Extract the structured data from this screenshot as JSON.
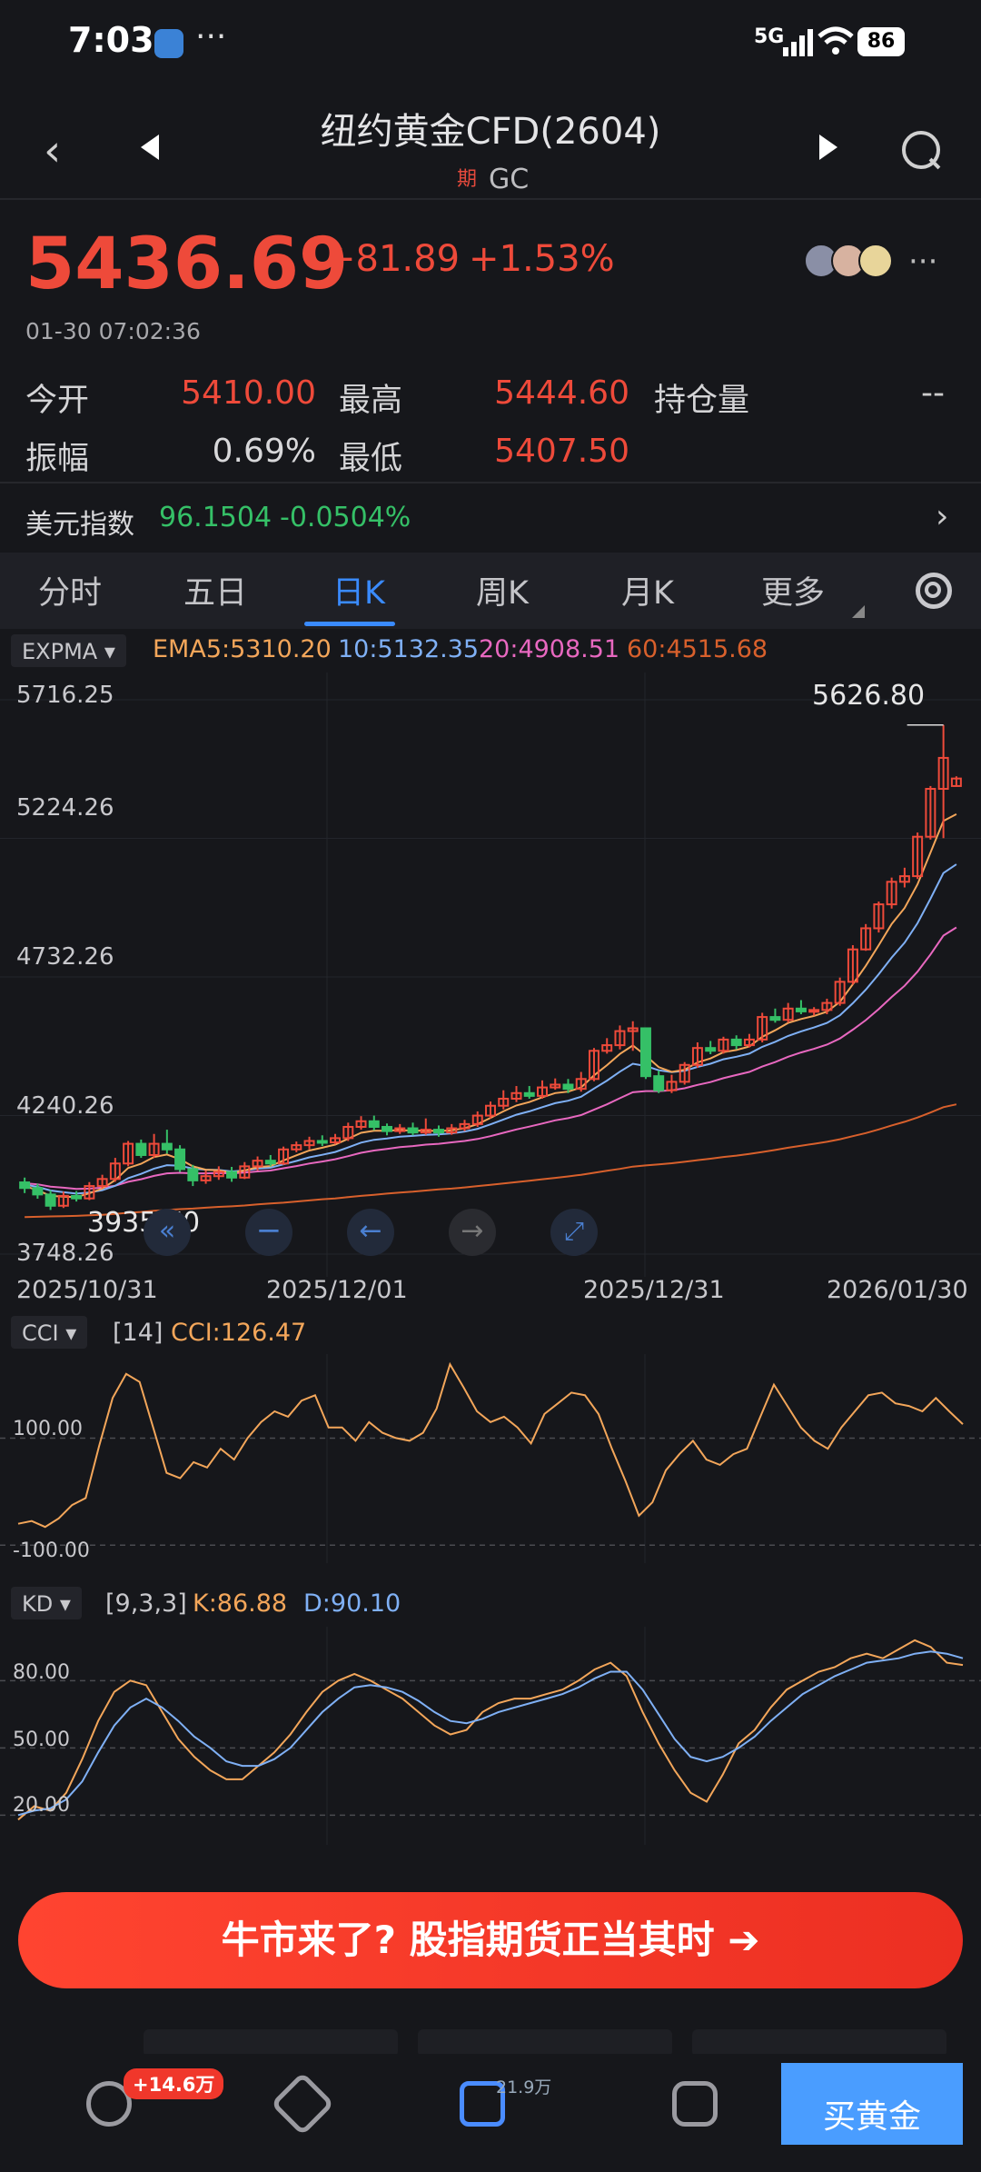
{
  "status": {
    "time": "7:03",
    "dots": "···",
    "signal": "5G",
    "battery": "86"
  },
  "header": {
    "title": "纽约黄金CFD(2604)",
    "tag": "期",
    "code": "GC"
  },
  "quote": {
    "price": "5436.69",
    "change": "+81.89",
    "change_pct": "+1.53%",
    "timestamp": "01-30 07:02:36",
    "stats": [
      {
        "label": "今开",
        "value": "5410.00"
      },
      {
        "label": "最高",
        "value": "5444.60"
      },
      {
        "label": "持仓量",
        "value": "--"
      },
      {
        "label": "振幅",
        "value": "0.69%"
      },
      {
        "label": "最低",
        "value": "5407.50"
      }
    ]
  },
  "usd_index": {
    "label": "美元指数",
    "value": "96.1504",
    "change": "-0.0504%"
  },
  "tabs": [
    {
      "label": "分时",
      "active": false
    },
    {
      "label": "五日",
      "active": false
    },
    {
      "label": "日K",
      "active": true
    },
    {
      "label": "周K",
      "active": false
    },
    {
      "label": "月K",
      "active": false
    },
    {
      "label": "更多",
      "active": false
    }
  ],
  "indicators": {
    "main": {
      "name": "EXPMA",
      "ema5": "EMA5:5310.20",
      "ema10": "10:5132.35",
      "ema20": "20:4908.51",
      "ema60": "60:4515.68"
    },
    "cci": {
      "name": "CCI",
      "param": "[14]",
      "value": "CCI:126.47"
    },
    "kd": {
      "name": "KD",
      "param": "[9,3,3]",
      "k": "K:86.88",
      "d": "D:90.10"
    }
  },
  "colors": {
    "up": "#ee4a3a",
    "down": "#35c067",
    "accent": "#3a8bff",
    "ema5": "#f3a65a",
    "ema10": "#7fb0f5",
    "ema20": "#e868c0",
    "ema60": "#d8602c"
  },
  "chart_data": [
    {
      "type": "candlestick",
      "y_ticks": [
        "5716.25",
        "5224.26",
        "4732.26",
        "4240.26",
        "3748.26"
      ],
      "x_labels": [
        "2025/10/31",
        "2025/12/01",
        "2025/12/31",
        "2026/01/30"
      ],
      "ylim": [
        3748.26,
        5716.25
      ],
      "max_label": "5626.80",
      "min_label": "3935.70",
      "candles": [
        [
          4003,
          3983,
          4020,
          3965
        ],
        [
          3983,
          3960,
          3998,
          3945
        ],
        [
          3960,
          3920,
          3975,
          3905
        ],
        [
          3920,
          3955,
          3970,
          3912
        ],
        [
          3955,
          3946,
          3972,
          3935
        ],
        [
          3946,
          3990,
          4004,
          3940
        ],
        [
          3990,
          4015,
          4030,
          3982
        ],
        [
          4015,
          4070,
          4090,
          4005
        ],
        [
          4070,
          4140,
          4150,
          4060
        ],
        [
          4140,
          4100,
          4155,
          4090
        ],
        [
          4100,
          4140,
          4175,
          4090
        ],
        [
          4140,
          4120,
          4190,
          4105
        ],
        [
          4120,
          4050,
          4135,
          4040
        ],
        [
          4050,
          4010,
          4065,
          3990
        ],
        [
          4010,
          4025,
          4045,
          3998
        ],
        [
          4025,
          4040,
          4060,
          4012
        ],
        [
          4040,
          4020,
          4058,
          4005
        ],
        [
          4020,
          4060,
          4075,
          4015
        ],
        [
          4060,
          4080,
          4095,
          4045
        ],
        [
          4080,
          4070,
          4100,
          4060
        ],
        [
          4070,
          4120,
          4130,
          4065
        ],
        [
          4120,
          4135,
          4148,
          4110
        ],
        [
          4135,
          4150,
          4165,
          4120
        ],
        [
          4150,
          4145,
          4170,
          4132
        ],
        [
          4145,
          4160,
          4175,
          4138
        ],
        [
          4160,
          4200,
          4215,
          4150
        ],
        [
          4200,
          4220,
          4238,
          4190
        ],
        [
          4220,
          4200,
          4240,
          4188
        ],
        [
          4200,
          4185,
          4212,
          4170
        ],
        [
          4185,
          4195,
          4210,
          4175
        ],
        [
          4195,
          4180,
          4215,
          4170
        ],
        [
          4180,
          4190,
          4230,
          4172
        ],
        [
          4190,
          4180,
          4205,
          4165
        ],
        [
          4180,
          4195,
          4210,
          4172
        ],
        [
          4195,
          4210,
          4225,
          4185
        ],
        [
          4210,
          4240,
          4255,
          4200
        ],
        [
          4240,
          4275,
          4290,
          4230
        ],
        [
          4275,
          4300,
          4330,
          4262
        ],
        [
          4300,
          4320,
          4345,
          4288
        ],
        [
          4320,
          4310,
          4345,
          4300
        ],
        [
          4310,
          4340,
          4365,
          4300
        ],
        [
          4340,
          4350,
          4372,
          4332
        ],
        [
          4350,
          4335,
          4370,
          4320
        ],
        [
          4335,
          4370,
          4395,
          4325
        ],
        [
          4370,
          4470,
          4480,
          4362
        ],
        [
          4470,
          4490,
          4515,
          4460
        ],
        [
          4490,
          4540,
          4560,
          4475
        ],
        [
          4540,
          4550,
          4575,
          4470
        ],
        [
          4550,
          4380,
          4552,
          4370
        ],
        [
          4380,
          4330,
          4400,
          4320
        ],
        [
          4330,
          4360,
          4385,
          4320
        ],
        [
          4360,
          4420,
          4430,
          4350
        ],
        [
          4420,
          4480,
          4500,
          4410
        ],
        [
          4480,
          4470,
          4505,
          4458
        ],
        [
          4470,
          4510,
          4520,
          4460
        ],
        [
          4510,
          4490,
          4525,
          4475
        ],
        [
          4490,
          4510,
          4530,
          4482
        ],
        [
          4510,
          4590,
          4605,
          4500
        ],
        [
          4590,
          4580,
          4620,
          4570
        ],
        [
          4580,
          4620,
          4640,
          4570
        ],
        [
          4620,
          4610,
          4650,
          4600
        ],
        [
          4610,
          4615,
          4625,
          4595
        ],
        [
          4615,
          4640,
          4655,
          4600
        ],
        [
          4640,
          4715,
          4730,
          4630
        ],
        [
          4715,
          4830,
          4845,
          4705
        ],
        [
          4830,
          4905,
          4920,
          4825
        ],
        [
          4905,
          4990,
          5000,
          4890
        ],
        [
          4990,
          5070,
          5085,
          4975
        ],
        [
          5070,
          5090,
          5120,
          5050
        ],
        [
          5090,
          5230,
          5245,
          5080
        ],
        [
          5230,
          5400,
          5410,
          5220
        ],
        [
          5400,
          5510,
          5626.8,
          5225
        ],
        [
          5410,
          5436.69,
          5444.6,
          5407.5
        ]
      ],
      "ema5": [
        3990,
        3975,
        3955,
        3952,
        3951,
        3964,
        3981,
        4011,
        4054,
        4069,
        4093,
        4102,
        4085,
        4060,
        4048,
        4046,
        4037,
        4045,
        4057,
        4061,
        4081,
        4099,
        4116,
        4126,
        4137,
        4158,
        4179,
        4186,
        4186,
        4189,
        4186,
        4187,
        4185,
        4188,
        4195,
        4210,
        4232,
        4255,
        4276,
        4288,
        4305,
        4320,
        4325,
        4340,
        4383,
        4419,
        4459,
        4489,
        4453,
        4412,
        4395,
        4403,
        4429,
        4443,
        4465,
        4473,
        4485,
        4520,
        4543,
        4569,
        4583,
        4594,
        4609,
        4644,
        4706,
        4772,
        4845,
        4920,
        4977,
        5061,
        5174,
        5286,
        5310
      ],
      "ema10": [
        3995,
        3987,
        3974,
        3968,
        3963,
        3967,
        3975,
        3991,
        4018,
        4033,
        4052,
        4064,
        4062,
        4052,
        4048,
        4047,
        4042,
        4045,
        4052,
        4055,
        4067,
        4079,
        4092,
        4101,
        4111,
        4127,
        4144,
        4154,
        4159,
        4165,
        4168,
        4172,
        4173,
        4177,
        4183,
        4193,
        4209,
        4226,
        4243,
        4255,
        4270,
        4284,
        4293,
        4307,
        4336,
        4364,
        4396,
        4424,
        4416,
        4401,
        4394,
        4399,
        4413,
        4424,
        4440,
        4449,
        4460,
        4484,
        4502,
        4523,
        4539,
        4553,
        4569,
        4596,
        4639,
        4687,
        4742,
        4801,
        4854,
        4923,
        5010,
        5101,
        5132
      ],
      "ema20": [
        4000,
        3996,
        3988,
        3984,
        3980,
        3981,
        3984,
        3991,
        4005,
        4014,
        4026,
        4035,
        4037,
        4035,
        4035,
        4036,
        4035,
        4038,
        4042,
        4045,
        4053,
        4061,
        4070,
        4077,
        4085,
        4096,
        4108,
        4116,
        4122,
        4128,
        4132,
        4137,
        4140,
        4145,
        4150,
        4157,
        4167,
        4179,
        4191,
        4201,
        4212,
        4223,
        4231,
        4242,
        4261,
        4280,
        4302,
        4323,
        4327,
        4327,
        4330,
        4337,
        4349,
        4359,
        4373,
        4384,
        4395,
        4414,
        4430,
        4449,
        4464,
        4477,
        4492,
        4514,
        4545,
        4579,
        4618,
        4661,
        4701,
        4751,
        4812,
        4879,
        4908
      ],
      "ema60": [
        3880,
        3881,
        3882,
        3883,
        3884,
        3886,
        3888,
        3891,
        3895,
        3898,
        3902,
        3905,
        3908,
        3910,
        3913,
        3916,
        3918,
        3921,
        3925,
        3928,
        3931,
        3935,
        3939,
        3943,
        3946,
        3951,
        3955,
        3959,
        3963,
        3967,
        3970,
        3974,
        3978,
        3981,
        3985,
        3990,
        3994,
        3999,
        4004,
        4009,
        4014,
        4019,
        4024,
        4030,
        4037,
        4044,
        4051,
        4059,
        4063,
        4067,
        4071,
        4076,
        4082,
        4087,
        4093,
        4098,
        4104,
        4111,
        4118,
        4126,
        4133,
        4140,
        4147,
        4156,
        4167,
        4178,
        4191,
        4205,
        4218,
        4233,
        4251,
        4270,
        4280
      ]
    },
    {
      "type": "line",
      "name": "CCI",
      "y_ticks": [
        "100.00",
        "-100.00"
      ],
      "ylim": [
        -120,
        240
      ],
      "values": [
        -60,
        -55,
        -66,
        -50,
        -25,
        -12,
        85,
        175,
        220,
        205,
        120,
        35,
        25,
        55,
        45,
        80,
        60,
        100,
        130,
        150,
        140,
        170,
        180,
        120,
        120,
        95,
        130,
        110,
        100,
        95,
        110,
        155,
        238,
        195,
        150,
        130,
        140,
        120,
        90,
        145,
        165,
        185,
        180,
        145,
        80,
        20,
        -45,
        -20,
        40,
        70,
        95,
        60,
        50,
        70,
        80,
        140,
        200,
        160,
        120,
        95,
        80,
        120,
        150,
        180,
        185,
        165,
        160,
        150,
        175,
        150,
        126
      ]
    },
    {
      "type": "line",
      "name": "KD",
      "y_ticks": [
        "80.00",
        "50.00",
        "20.00"
      ],
      "ylim": [
        10,
        100
      ],
      "series": [
        {
          "name": "K",
          "values": [
            18,
            24,
            22,
            30,
            45,
            62,
            75,
            80,
            78,
            66,
            54,
            46,
            40,
            36,
            36,
            42,
            48,
            56,
            66,
            75,
            80,
            83,
            80,
            76,
            72,
            66,
            60,
            56,
            58,
            66,
            70,
            72,
            72,
            74,
            76,
            80,
            85,
            88,
            82,
            66,
            52,
            40,
            30,
            26,
            38,
            52,
            58,
            68,
            76,
            80,
            84,
            86,
            90,
            92,
            90,
            94,
            98,
            95,
            88,
            87
          ]
        },
        {
          "name": "D",
          "values": [
            20,
            22,
            23,
            27,
            35,
            48,
            60,
            68,
            72,
            68,
            62,
            55,
            50,
            44,
            42,
            42,
            45,
            50,
            58,
            66,
            72,
            77,
            78,
            77,
            75,
            71,
            66,
            62,
            61,
            63,
            66,
            68,
            70,
            72,
            74,
            77,
            81,
            84,
            84,
            76,
            65,
            54,
            46,
            44,
            46,
            50,
            55,
            62,
            68,
            74,
            78,
            82,
            85,
            88,
            89,
            90,
            92,
            93,
            92,
            90
          ]
        }
      ]
    }
  ],
  "cta": {
    "text": "牛市来了? 股指期货正当其时 ➔"
  },
  "bottom_nav": {
    "badge1": "+14.6万",
    "badge2": "21.9万",
    "buy": "买黄金"
  }
}
